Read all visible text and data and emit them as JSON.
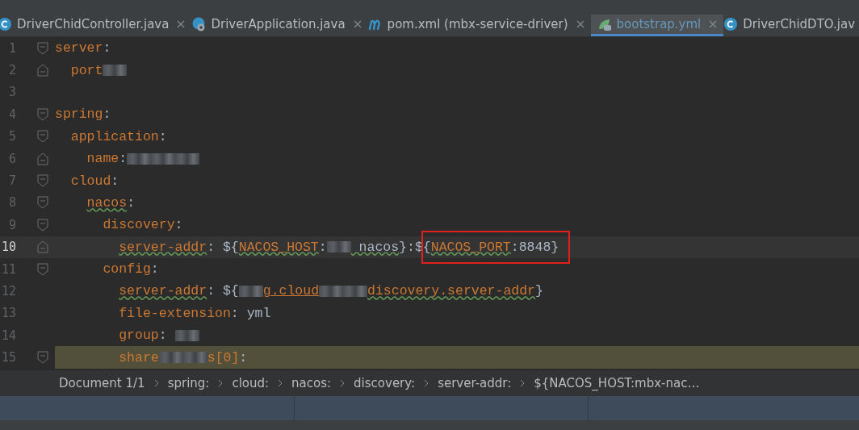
{
  "tabs": [
    {
      "kind": "class",
      "label": "DriverChidController.java",
      "selected": false,
      "closable": true
    },
    {
      "kind": "app",
      "label": "DriverApplication.java",
      "selected": false,
      "closable": true
    },
    {
      "kind": "maven",
      "label": "pom.xml (mbx-service-driver)",
      "selected": false,
      "closable": true
    },
    {
      "kind": "yaml",
      "label": "bootstrap.yml",
      "selected": true,
      "closable": true
    },
    {
      "kind": "class",
      "label": "DriverChidDTO.jav",
      "selected": false,
      "closable": false
    }
  ],
  "editor": {
    "lines": [
      {
        "number": "1",
        "fold": {
          "kind": "start"
        },
        "current": false,
        "highlighted": false,
        "segments": [
          {
            "kind": "key",
            "text": "server",
            "typo": false
          },
          {
            "kind": "punct",
            "text": ":"
          }
        ],
        "children": [
          {
            "number": "2",
            "fold": {
              "kind": "end"
            },
            "current": false,
            "highlighted": false,
            "segments": [
              {
                "kind": "key",
                "text": "port",
                "typo": false
              },
              {
                "kind": "redacted"
              }
            ]
          }
        ]
      },
      {
        "number": "3",
        "current": false,
        "highlighted": false
      },
      {
        "number": "4",
        "fold": {
          "kind": "start"
        },
        "current": false,
        "highlighted": false,
        "segments": [
          {
            "kind": "key",
            "text": "spring",
            "typo": false
          },
          {
            "kind": "punct",
            "text": ":"
          }
        ],
        "children": [
          {
            "number": "5",
            "fold": {
              "kind": "start"
            },
            "current": false,
            "highlighted": false,
            "segments": [
              {
                "kind": "key",
                "text": "application",
                "typo": false
              },
              {
                "kind": "punct",
                "text": ":"
              }
            ],
            "children": [
              {
                "number": "6",
                "fold": {
                  "kind": "end"
                },
                "current": false,
                "highlighted": false,
                "segments": [
                  {
                    "kind": "key",
                    "text": "name",
                    "typo": false
                  },
                  {
                    "kind": "punct",
                    "text": ":"
                  },
                  {
                    "kind": "redacted"
                  },
                  {
                    "kind": "redacted"
                  },
                  {
                    "kind": "redacted"
                  }
                ]
              }
            ]
          },
          {
            "number": "7",
            "fold": {
              "kind": "start"
            },
            "current": false,
            "highlighted": false,
            "segments": [
              {
                "kind": "key",
                "text": "cloud",
                "typo": false
              },
              {
                "kind": "punct",
                "text": ":"
              }
            ],
            "children": [
              {
                "number": "8",
                "fold": {
                  "kind": "start"
                },
                "current": false,
                "highlighted": false,
                "segments": [
                  {
                    "kind": "key",
                    "text": "nacos",
                    "typo": true
                  },
                  {
                    "kind": "punct",
                    "text": ":"
                  }
                ],
                "children": [
                  {
                    "number": "9",
                    "fold": {
                      "kind": "start"
                    },
                    "current": false,
                    "highlighted": false,
                    "segments": [
                      {
                        "kind": "key",
                        "text": "discovery",
                        "typo": false
                      },
                      {
                        "kind": "punct",
                        "text": ":"
                      }
                    ],
                    "children": [
                      {
                        "number": "10",
                        "fold": {
                          "kind": "end"
                        },
                        "current": true,
                        "highlighted": false,
                        "segments": [
                          {
                            "kind": "key",
                            "text": "server-addr",
                            "typo": true
                          },
                          {
                            "kind": "punct",
                            "text": ": ${"
                          },
                          {
                            "kind": "ref",
                            "text": "NACOS_HOST",
                            "typo": true
                          },
                          {
                            "kind": "punct",
                            "text": ":"
                          },
                          {
                            "kind": "redacted"
                          },
                          {
                            "kind": "value",
                            "text": " nacos",
                            "typo": true
                          },
                          {
                            "kind": "punct",
                            "text": "}:$"
                          },
                          {
                            "kind": "boxed",
                            "segments": [
                              {
                                "kind": "punct",
                                "text": "{"
                              },
                              {
                                "kind": "ref",
                                "text": "NACOS_PORT",
                                "typo": true
                              },
                              {
                                "kind": "punct",
                                "text": ":"
                              },
                              {
                                "kind": "value",
                                "text": "8848}",
                                "typo": false
                              }
                            ]
                          }
                        ]
                      }
                    ]
                  },
                  {
                    "number": "11",
                    "fold": {
                      "kind": "start"
                    },
                    "current": false,
                    "highlighted": false,
                    "segments": [
                      {
                        "kind": "key",
                        "text": "config",
                        "typo": false
                      },
                      {
                        "kind": "punct",
                        "text": ":"
                      }
                    ],
                    "children": [
                      {
                        "number": "12",
                        "current": false,
                        "highlighted": false,
                        "segments": [
                          {
                            "kind": "key",
                            "text": "server-addr",
                            "typo": true
                          },
                          {
                            "kind": "punct",
                            "text": ": ${"
                          },
                          {
                            "kind": "redacted"
                          },
                          {
                            "kind": "ref",
                            "text": "g.cloud",
                            "typo": false
                          },
                          {
                            "kind": "redacted"
                          },
                          {
                            "kind": "redacted"
                          },
                          {
                            "kind": "ref",
                            "text": "discovery.server-addr",
                            "typo": true
                          },
                          {
                            "kind": "punct",
                            "text": "}"
                          }
                        ]
                      },
                      {
                        "number": "13",
                        "current": false,
                        "highlighted": false,
                        "segments": [
                          {
                            "kind": "key",
                            "text": "file-extension",
                            "typo": false
                          },
                          {
                            "kind": "punct",
                            "text": ": "
                          },
                          {
                            "kind": "value",
                            "text": "yml",
                            "typo": false
                          }
                        ]
                      },
                      {
                        "number": "14",
                        "current": false,
                        "highlighted": false,
                        "segments": [
                          {
                            "kind": "key",
                            "text": "group",
                            "typo": false
                          },
                          {
                            "kind": "punct",
                            "text": ": "
                          },
                          {
                            "kind": "redacted"
                          }
                        ]
                      },
                      {
                        "number": "15",
                        "fold": {
                          "kind": "start"
                        },
                        "current": false,
                        "highlighted": true,
                        "segments": [
                          {
                            "kind": "key",
                            "text": "share",
                            "typo": false
                          },
                          {
                            "kind": "redacted"
                          },
                          {
                            "kind": "redacted"
                          },
                          {
                            "kind": "key",
                            "text": "s[0]",
                            "typo": false
                          },
                          {
                            "kind": "punct",
                            "text": ":"
                          }
                        ]
                      }
                    ]
                  }
                ]
              }
            ]
          }
        ]
      }
    ]
  },
  "breadcrumbs": [
    "Document 1/1",
    "spring:",
    "cloud:",
    "nacos:",
    "discovery:",
    "server-addr:",
    "${NACOS_HOST:mbx-nac…"
  ]
}
